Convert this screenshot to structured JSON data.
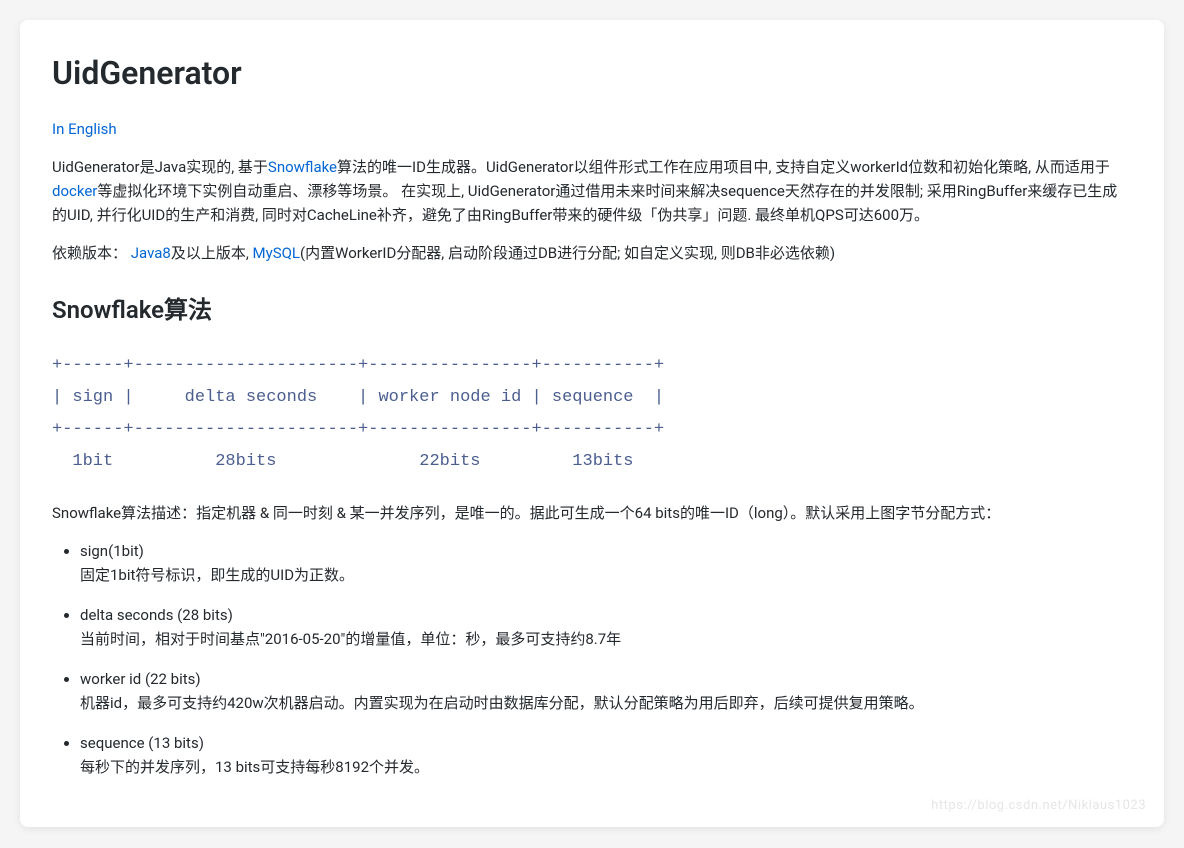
{
  "title": "UidGenerator",
  "english_link": "In English",
  "intro": {
    "p1_a": "UidGenerator是Java实现的, 基于",
    "link_snowflake": "Snowflake",
    "p1_b": "算法的唯一ID生成器。UidGenerator以组件形式工作在应用项目中, 支持自定义workerId位数和初始化策略, 从而适用于",
    "link_docker": "docker",
    "p1_c": "等虚拟化环境下实例自动重启、漂移等场景。 在实现上, UidGenerator通过借用未来时间来解决sequence天然存在的并发限制; 采用RingBuffer来缓存已生成的UID, 并行化UID的生产和消费, 同时对CacheLine补齐，避免了由RingBuffer带来的硬件级「伪共享」问题. 最终单机QPS可达600万。"
  },
  "deps": {
    "prefix": "依赖版本：",
    "link_java8": "Java8",
    "after_java8": "及以上版本, ",
    "link_mysql": "MySQL",
    "after_mysql": "(内置WorkerID分配器, 启动阶段通过DB进行分配; 如自定义实现, 则DB非必选依赖)"
  },
  "section_heading": "Snowflake算法",
  "diagram": "+------+----------------------+----------------+-----------+\n| sign |     delta seconds    | worker node id | sequence  |\n+------+----------------------+----------------+-----------+\n  1bit          28bits              22bits         13bits",
  "algo_desc": "Snowflake算法描述：指定机器 & 同一时刻 & 某一并发序列，是唯一的。据此可生成一个64 bits的唯一ID（long）。默认采用上图字节分配方式：",
  "bits": [
    {
      "title": "sign(1bit)",
      "desc": "固定1bit符号标识，即生成的UID为正数。"
    },
    {
      "title": "delta seconds (28 bits)",
      "desc": "当前时间，相对于时间基点\"2016-05-20\"的增量值，单位：秒，最多可支持约8.7年"
    },
    {
      "title": "worker id (22 bits)",
      "desc": "机器id，最多可支持约420w次机器启动。内置实现为在启动时由数据库分配，默认分配策略为用后即弃，后续可提供复用策略。"
    },
    {
      "title": "sequence (13 bits)",
      "desc": "每秒下的并发序列，13 bits可支持每秒8192个并发。"
    }
  ],
  "watermark": "https://blog.csdn.net/Niklaus1023"
}
